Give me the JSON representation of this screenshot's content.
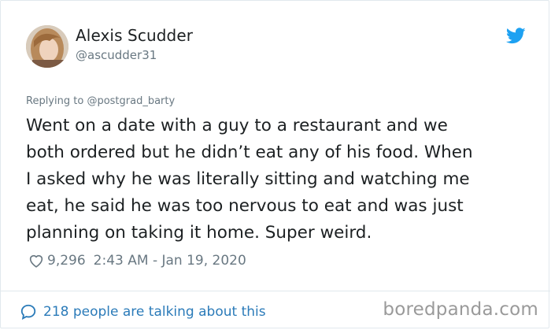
{
  "tweet": {
    "display_name": "Alexis Scudder",
    "handle": "@ascudder31",
    "reply_prefix": "Replying to ",
    "reply_to": "@postgrad_barty",
    "text": "Went on a date with a guy to a restaurant and we\nboth ordered but he didn’t eat any of his food. When\nI asked why he was literally sitting and watching me\neat, he said he was too nervous to eat and was just\nplanning on taking it home. Super weird.",
    "likes": "9,296",
    "timestamp": "2:43 AM - Jan 19, 2020",
    "conversation_link": "218 people are talking about this"
  },
  "icons": {
    "brand": "twitter-bird-icon",
    "like": "heart-icon",
    "conversation": "speech-bubble-icon"
  },
  "watermark": "boredpanda.com",
  "colors": {
    "twitter_blue": "#1da1f2",
    "link_blue": "#2b7bb9",
    "secondary_text": "#697882",
    "primary_text": "#1c2022",
    "border": "#e1e8ed",
    "watermark": "#9a9a9a"
  }
}
